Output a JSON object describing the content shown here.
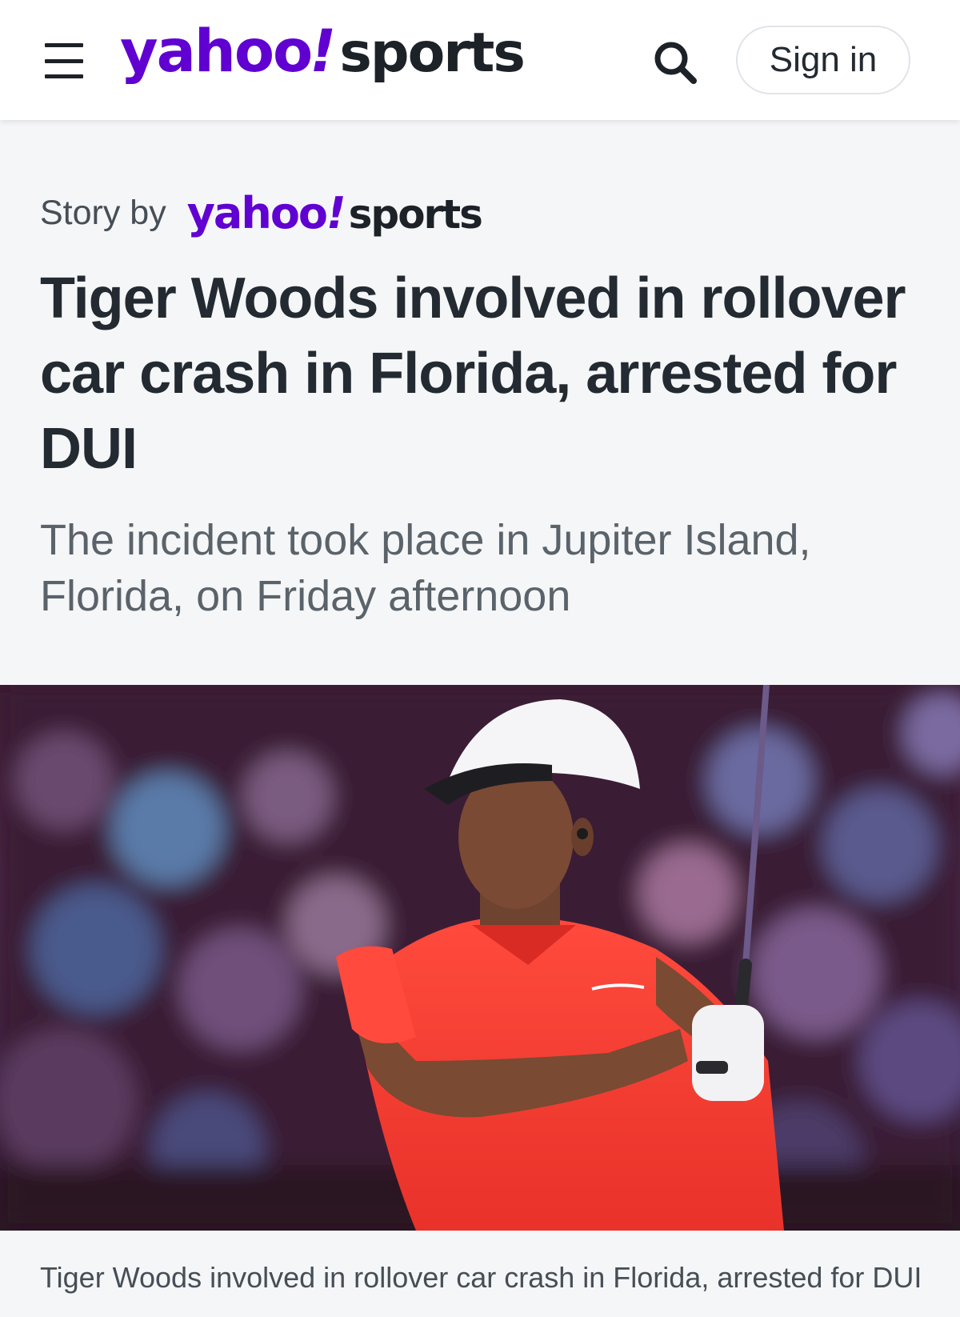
{
  "header": {
    "logo_yahoo": "yahoo",
    "logo_bang": "!",
    "logo_sports": "sports",
    "signin_label": "Sign in",
    "menu_icon": "hamburger-menu-icon",
    "search_icon": "search-icon"
  },
  "byline": {
    "prefix": "Story by",
    "logo_yahoo": "yahoo",
    "logo_bang": "!",
    "logo_sports": "sports"
  },
  "article": {
    "headline": "Tiger Woods involved in rollover car crash in Florida, arrested for DUI",
    "subheadline": "The incident took place in Jupiter Island, Florida, on Friday afternoon"
  },
  "hero": {
    "caption": "Tiger Woods involved in rollover car crash in Florida, arrested for DUI"
  },
  "colors": {
    "brand_purple": "#6001d2",
    "text_dark": "#232a31",
    "text_muted": "#5b636a",
    "page_bg": "#f5f6f8"
  }
}
